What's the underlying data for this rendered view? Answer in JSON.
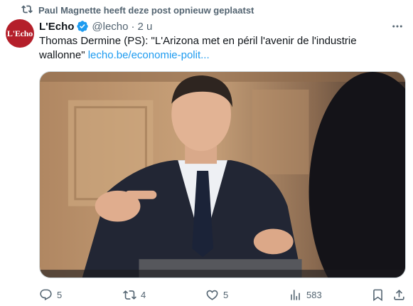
{
  "repost": {
    "text": "Paul Magnette heeft deze post opnieuw geplaatst",
    "icon": "repost-icon"
  },
  "author": {
    "avatar_text": "L'Echo",
    "name": "L'Echo",
    "verified": true,
    "handle": "@lecho",
    "separator": "·",
    "time": "2 u"
  },
  "post": {
    "text": "Thomas Dermine (PS): \"L'Arizona met en péril l'avenir de l'industrie wallonne\"",
    "link": "lecho.be/economie-polit..."
  },
  "actions": {
    "replies": "5",
    "reposts": "4",
    "likes": "5",
    "views": "583"
  },
  "colors": {
    "text_primary": "#0f1419",
    "text_secondary": "#536471",
    "link": "#1d9bf0",
    "verified_badge": "#1d9bf0",
    "avatar_bg": "#b41f2a"
  }
}
